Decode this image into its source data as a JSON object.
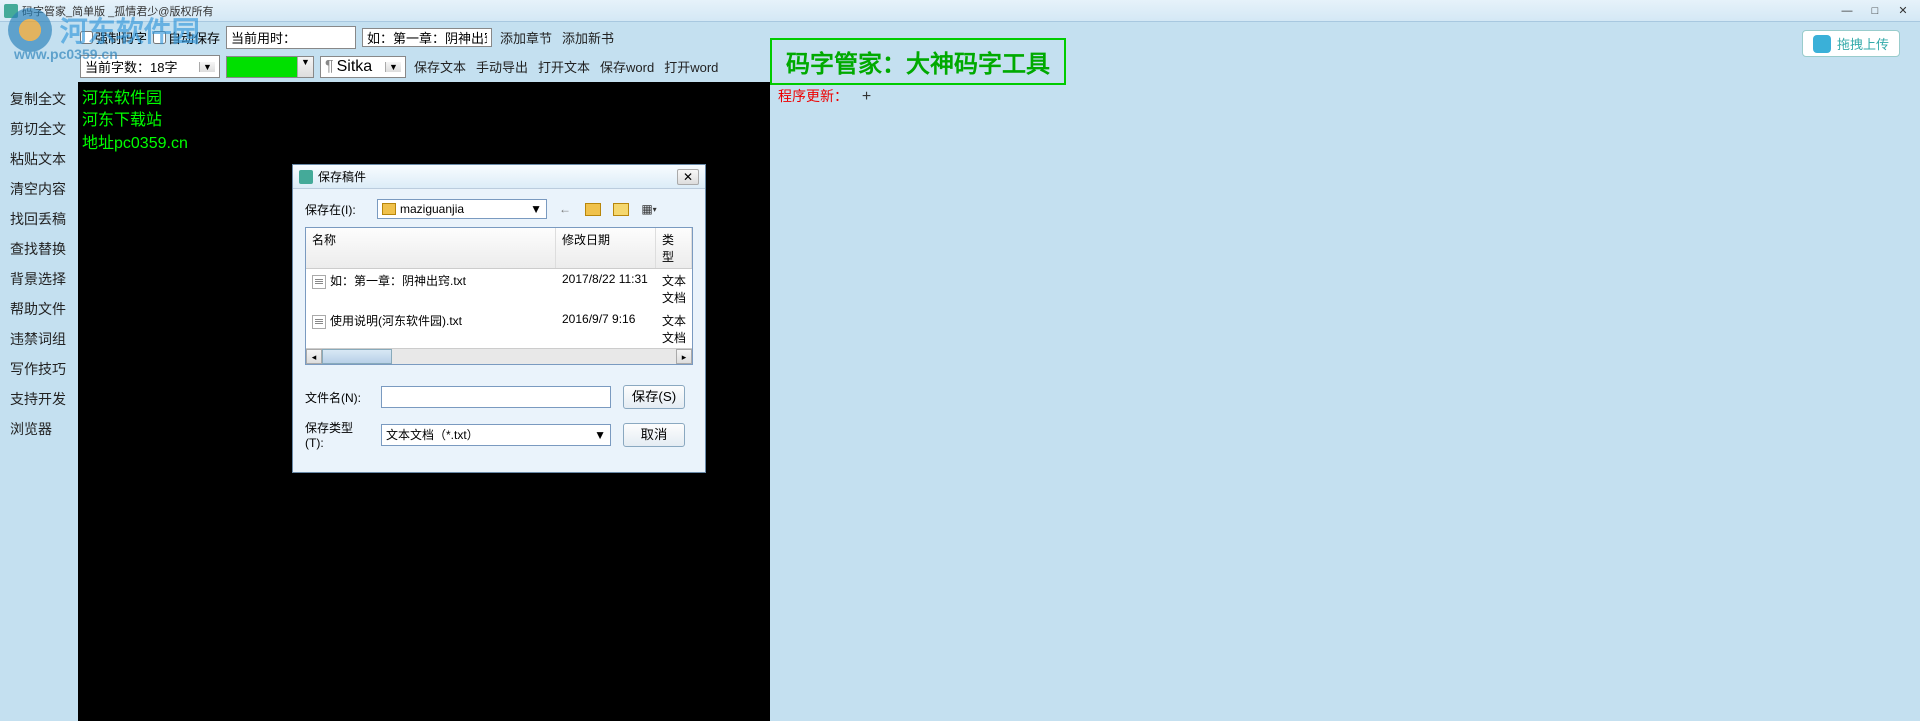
{
  "titlebar": {
    "title": "码字管家_简单版 _孤情君少@版权所有"
  },
  "toolbar": {
    "force_typing": "强制码字",
    "auto_save": "自动保存",
    "time_label": "当前用时：",
    "time_value": "",
    "example_field": "如：第一章：阴神出窍",
    "add_chapter": "添加章节",
    "add_book": "添加新书",
    "word_count": "当前字数：18字",
    "font_name": "Sitka",
    "save_text": "保存文本",
    "manual_export": "手动导出",
    "open_text": "打开文本",
    "save_word": "保存word",
    "open_word": "打开word"
  },
  "banner": "码字管家：大神码字工具",
  "upload": {
    "label": "拖拽上传"
  },
  "sidebar": {
    "items": [
      "复制全文",
      "剪切全文",
      "粘贴文本",
      "清空内容",
      "找回丢稿",
      "查找替换",
      "背景选择",
      "帮助文件",
      "违禁词组",
      "写作技巧",
      "支持开发",
      "浏览器"
    ]
  },
  "editor": {
    "lines": [
      "河东软件园",
      "河东下载站",
      "地址pc0359.cn"
    ]
  },
  "right_panel": {
    "update_label": "程序更新：",
    "plus": "+"
  },
  "dialog": {
    "title": "保存稿件",
    "save_in_label": "保存在(I):",
    "folder": "maziguanjia",
    "columns": {
      "name": "名称",
      "date": "修改日期",
      "type": "类型"
    },
    "files": [
      {
        "name": "如：第一章：阴神出窍.txt",
        "date": "2017/8/22 11:31",
        "type": "文本文档"
      },
      {
        "name": "使用说明(河东软件园).txt",
        "date": "2016/9/7 9:16",
        "type": "文本文档"
      }
    ],
    "filename_label": "文件名(N):",
    "filename_value": "",
    "filetype_label": "保存类型(T):",
    "filetype_value": "文本文档（*.txt）",
    "save_btn": "保存(S)",
    "cancel_btn": "取消"
  },
  "watermark": {
    "text": "河东软件园",
    "url": "www.pc0359.cn"
  }
}
